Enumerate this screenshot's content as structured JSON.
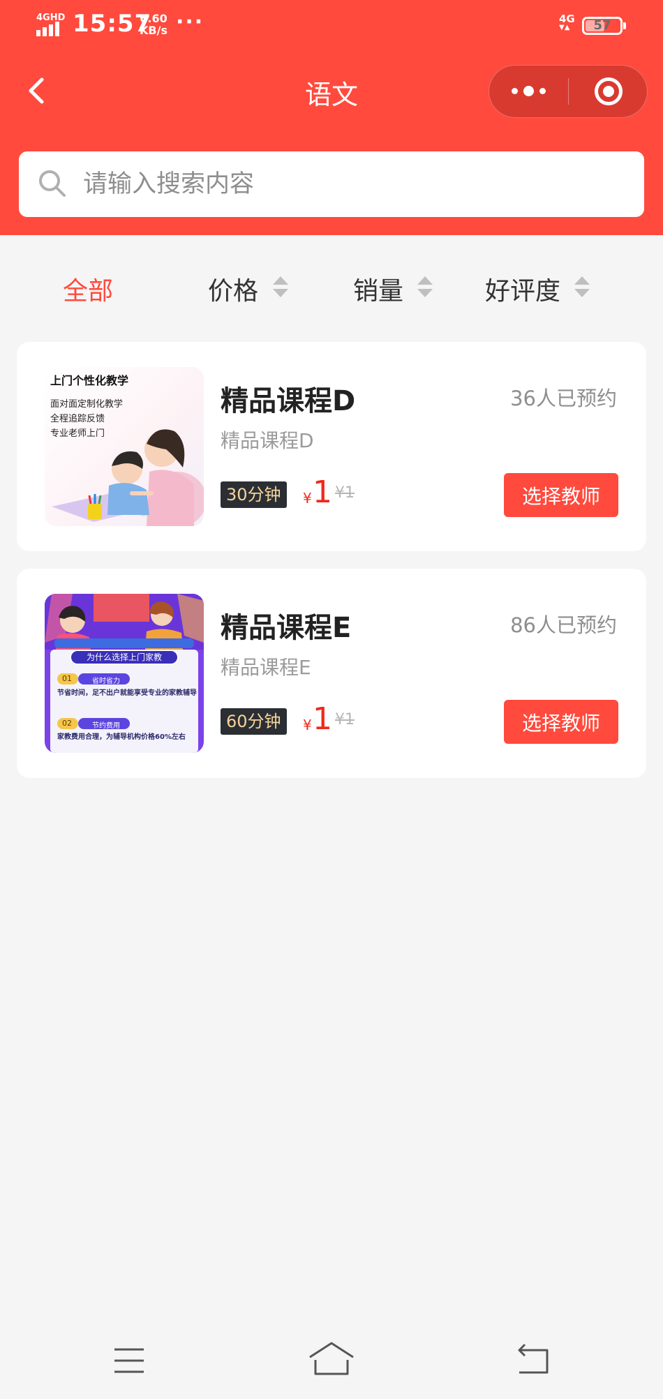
{
  "status_bar": {
    "signal_label": "4GHD",
    "time": "15:57",
    "speed_value": "6.60",
    "speed_unit": "KB/s",
    "dots": "···",
    "network": "4G",
    "battery": "57",
    "battery_level": 0.57
  },
  "header": {
    "title": "语文",
    "back_icon": "back-chevron-icon",
    "more_icon": "more-dots-icon",
    "close_icon": "target-circle-icon",
    "color": "#ff4a3d"
  },
  "search": {
    "placeholder": "请输入搜索内容",
    "value": ""
  },
  "sort_tabs": [
    {
      "label": "全部",
      "active": true
    },
    {
      "label": "价格",
      "active": false
    },
    {
      "label": "销量",
      "active": false
    },
    {
      "label": "好评度",
      "active": false
    }
  ],
  "courses": [
    {
      "title": "精品课程D",
      "subtitle": "精品课程D",
      "booked": "36人已预约",
      "duration": "30分钟",
      "currency": "¥",
      "price": "1",
      "original_price": "¥1",
      "button": "选择教师",
      "thumb": {
        "headline": "上门个性化教学",
        "lines": [
          "面对面定制化教学",
          "全程追踪反馈",
          "专业老师上门"
        ]
      }
    },
    {
      "title": "精品课程E",
      "subtitle": "精品课程E",
      "booked": "86人已预约",
      "duration": "60分钟",
      "currency": "¥",
      "price": "1",
      "original_price": "¥1",
      "button": "选择教师",
      "thumb": {
        "banner": "为什么选择上门家教",
        "items": [
          {
            "num": "01",
            "title": "省时省力",
            "desc": "节省时间，足不出户就能享受专业的家教辅导"
          },
          {
            "num": "02",
            "title": "节约费用",
            "desc": "家教费用合理，为辅导机构价格60%左右"
          }
        ]
      }
    }
  ],
  "bottom_nav": {
    "menu_icon": "menu-lines-icon",
    "home_icon": "home-icon",
    "back_icon": "return-icon"
  },
  "colors": {
    "accent": "#ff4a3d",
    "price": "#f0291b",
    "tag_bg": "#2b2f34",
    "tag_text": "#f6d39a"
  }
}
